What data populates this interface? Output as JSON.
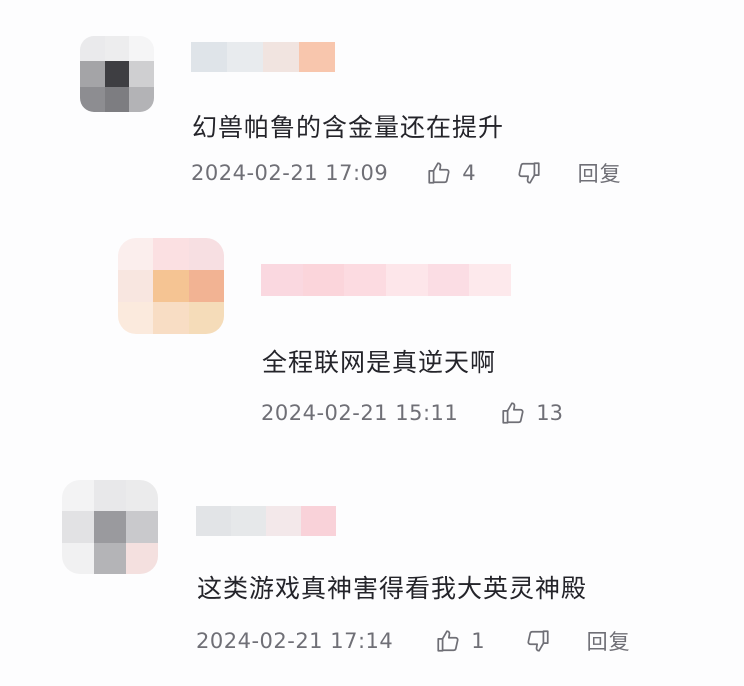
{
  "comments": [
    {
      "text": "幻兽帕鲁的含金量还在提升",
      "time": "2024-02-21 17:09",
      "likes": "4",
      "reply_label": "回复",
      "avatar_colors": [
        "#eaeaec",
        "#ededee",
        "#f5f5f6",
        "#a4a4a7",
        "#3e3e42",
        "#cfcfd1",
        "#8d8d91",
        "#7d7d81",
        "#b3b3b6"
      ],
      "name_colors": [
        "#dfe4e9",
        "#e8ebee",
        "#f1e4e0",
        "#f8c6ad"
      ]
    },
    {
      "text": "全程联网是真逆天啊",
      "time": "2024-02-21 15:11",
      "likes": "13",
      "reply_label": "",
      "avatar_colors": [
        "#fbeeed",
        "#fbe0e2",
        "#f7dfe2",
        "#f8e6e0",
        "#f5c493",
        "#f2b393",
        "#fbeadd",
        "#f8ddc4",
        "#f5dcb9"
      ],
      "name_colors": [
        "#fad8e0",
        "#fbd5db",
        "#fcdbe1",
        "#fde6ea",
        "#fbdde4",
        "#fde9ec"
      ]
    },
    {
      "text": "这类游戏真神害得看我大英灵神殿",
      "time": "2024-02-21 17:14",
      "likes": "1",
      "reply_label": "回复",
      "avatar_colors": [
        "#f3f3f4",
        "#e8e8ea",
        "#ebebec",
        "#e2e2e4",
        "#9a9a9e",
        "#c9c9cc",
        "#f1f1f2",
        "#b4b4b7",
        "#f4e0df"
      ],
      "name_colors": [
        "#e2e4e7",
        "#e6e8ea",
        "#f3e8ea",
        "#f9d2d9"
      ]
    }
  ],
  "icons": {
    "like": "thumbs-up-icon",
    "dislike": "thumbs-down-icon"
  }
}
